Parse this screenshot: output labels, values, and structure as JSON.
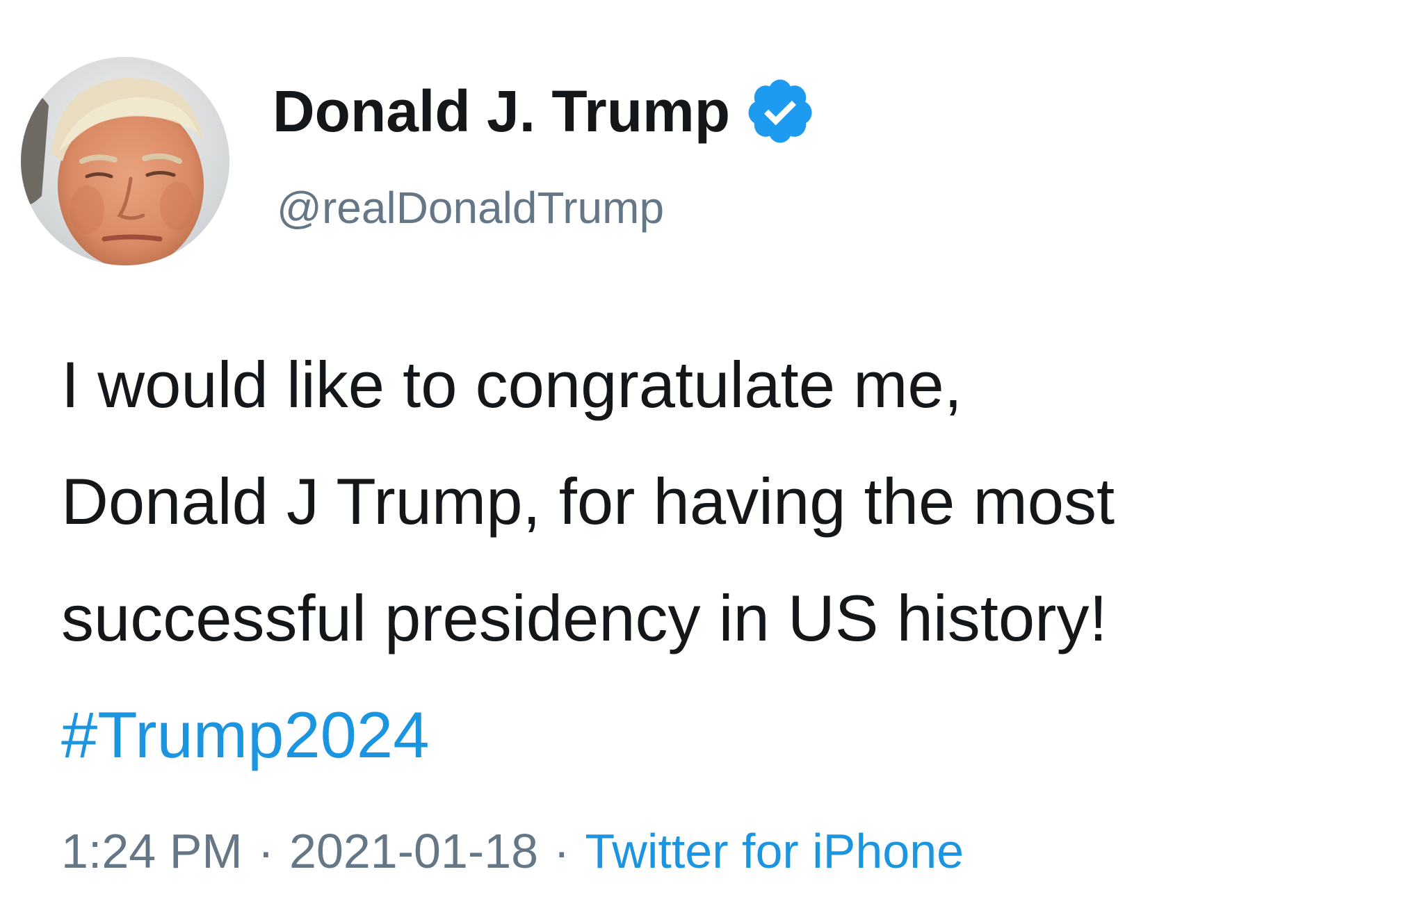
{
  "tweet": {
    "display_name": "Donald J. Trump",
    "handle": "@realDonaldTrump",
    "verified": true,
    "verified_icon": "verified-badge-icon",
    "body_lines": [
      "I would like to congratulate me,",
      "Donald J Trump, for having the most",
      "successful presidency in US history!"
    ],
    "hashtag": "#Trump2024",
    "time": "1:24 PM",
    "separator": "·",
    "date": "2021-01-18",
    "source": "Twitter for iPhone"
  },
  "colors": {
    "text_primary": "#14171a",
    "text_secondary": "#657786",
    "link_blue": "#1b95e0",
    "verified_blue": "#1d9bf0",
    "background": "#ffffff"
  }
}
